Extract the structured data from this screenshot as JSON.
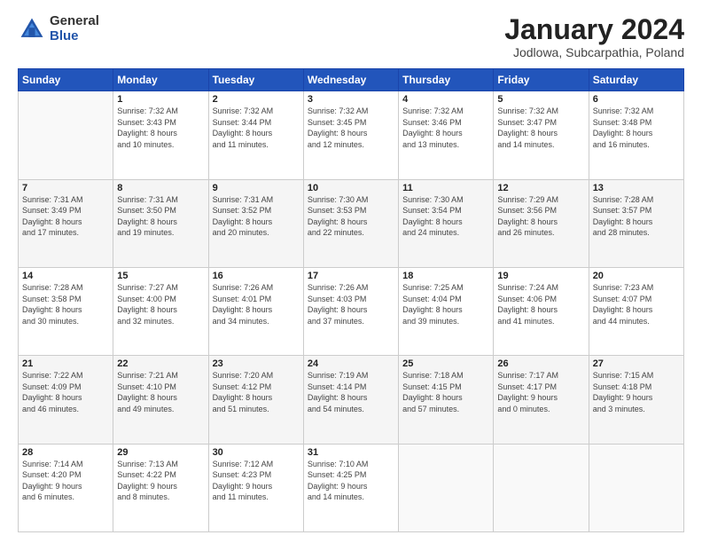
{
  "header": {
    "logo_general": "General",
    "logo_blue": "Blue",
    "month_title": "January 2024",
    "location": "Jodlowa, Subcarpathia, Poland"
  },
  "weekdays": [
    "Sunday",
    "Monday",
    "Tuesday",
    "Wednesday",
    "Thursday",
    "Friday",
    "Saturday"
  ],
  "weeks": [
    [
      {
        "day": "",
        "info": ""
      },
      {
        "day": "1",
        "info": "Sunrise: 7:32 AM\nSunset: 3:43 PM\nDaylight: 8 hours\nand 10 minutes."
      },
      {
        "day": "2",
        "info": "Sunrise: 7:32 AM\nSunset: 3:44 PM\nDaylight: 8 hours\nand 11 minutes."
      },
      {
        "day": "3",
        "info": "Sunrise: 7:32 AM\nSunset: 3:45 PM\nDaylight: 8 hours\nand 12 minutes."
      },
      {
        "day": "4",
        "info": "Sunrise: 7:32 AM\nSunset: 3:46 PM\nDaylight: 8 hours\nand 13 minutes."
      },
      {
        "day": "5",
        "info": "Sunrise: 7:32 AM\nSunset: 3:47 PM\nDaylight: 8 hours\nand 14 minutes."
      },
      {
        "day": "6",
        "info": "Sunrise: 7:32 AM\nSunset: 3:48 PM\nDaylight: 8 hours\nand 16 minutes."
      }
    ],
    [
      {
        "day": "7",
        "info": "Sunrise: 7:31 AM\nSunset: 3:49 PM\nDaylight: 8 hours\nand 17 minutes."
      },
      {
        "day": "8",
        "info": "Sunrise: 7:31 AM\nSunset: 3:50 PM\nDaylight: 8 hours\nand 19 minutes."
      },
      {
        "day": "9",
        "info": "Sunrise: 7:31 AM\nSunset: 3:52 PM\nDaylight: 8 hours\nand 20 minutes."
      },
      {
        "day": "10",
        "info": "Sunrise: 7:30 AM\nSunset: 3:53 PM\nDaylight: 8 hours\nand 22 minutes."
      },
      {
        "day": "11",
        "info": "Sunrise: 7:30 AM\nSunset: 3:54 PM\nDaylight: 8 hours\nand 24 minutes."
      },
      {
        "day": "12",
        "info": "Sunrise: 7:29 AM\nSunset: 3:56 PM\nDaylight: 8 hours\nand 26 minutes."
      },
      {
        "day": "13",
        "info": "Sunrise: 7:28 AM\nSunset: 3:57 PM\nDaylight: 8 hours\nand 28 minutes."
      }
    ],
    [
      {
        "day": "14",
        "info": "Sunrise: 7:28 AM\nSunset: 3:58 PM\nDaylight: 8 hours\nand 30 minutes."
      },
      {
        "day": "15",
        "info": "Sunrise: 7:27 AM\nSunset: 4:00 PM\nDaylight: 8 hours\nand 32 minutes."
      },
      {
        "day": "16",
        "info": "Sunrise: 7:26 AM\nSunset: 4:01 PM\nDaylight: 8 hours\nand 34 minutes."
      },
      {
        "day": "17",
        "info": "Sunrise: 7:26 AM\nSunset: 4:03 PM\nDaylight: 8 hours\nand 37 minutes."
      },
      {
        "day": "18",
        "info": "Sunrise: 7:25 AM\nSunset: 4:04 PM\nDaylight: 8 hours\nand 39 minutes."
      },
      {
        "day": "19",
        "info": "Sunrise: 7:24 AM\nSunset: 4:06 PM\nDaylight: 8 hours\nand 41 minutes."
      },
      {
        "day": "20",
        "info": "Sunrise: 7:23 AM\nSunset: 4:07 PM\nDaylight: 8 hours\nand 44 minutes."
      }
    ],
    [
      {
        "day": "21",
        "info": "Sunrise: 7:22 AM\nSunset: 4:09 PM\nDaylight: 8 hours\nand 46 minutes."
      },
      {
        "day": "22",
        "info": "Sunrise: 7:21 AM\nSunset: 4:10 PM\nDaylight: 8 hours\nand 49 minutes."
      },
      {
        "day": "23",
        "info": "Sunrise: 7:20 AM\nSunset: 4:12 PM\nDaylight: 8 hours\nand 51 minutes."
      },
      {
        "day": "24",
        "info": "Sunrise: 7:19 AM\nSunset: 4:14 PM\nDaylight: 8 hours\nand 54 minutes."
      },
      {
        "day": "25",
        "info": "Sunrise: 7:18 AM\nSunset: 4:15 PM\nDaylight: 8 hours\nand 57 minutes."
      },
      {
        "day": "26",
        "info": "Sunrise: 7:17 AM\nSunset: 4:17 PM\nDaylight: 9 hours\nand 0 minutes."
      },
      {
        "day": "27",
        "info": "Sunrise: 7:15 AM\nSunset: 4:18 PM\nDaylight: 9 hours\nand 3 minutes."
      }
    ],
    [
      {
        "day": "28",
        "info": "Sunrise: 7:14 AM\nSunset: 4:20 PM\nDaylight: 9 hours\nand 6 minutes."
      },
      {
        "day": "29",
        "info": "Sunrise: 7:13 AM\nSunset: 4:22 PM\nDaylight: 9 hours\nand 8 minutes."
      },
      {
        "day": "30",
        "info": "Sunrise: 7:12 AM\nSunset: 4:23 PM\nDaylight: 9 hours\nand 11 minutes."
      },
      {
        "day": "31",
        "info": "Sunrise: 7:10 AM\nSunset: 4:25 PM\nDaylight: 9 hours\nand 14 minutes."
      },
      {
        "day": "",
        "info": ""
      },
      {
        "day": "",
        "info": ""
      },
      {
        "day": "",
        "info": ""
      }
    ]
  ]
}
